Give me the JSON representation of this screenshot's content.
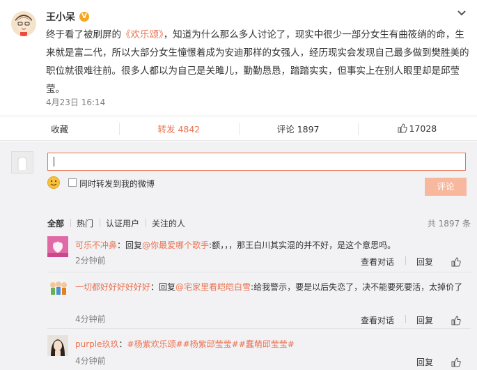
{
  "post": {
    "author": "王小呆",
    "verify_badge": "V",
    "text_before": "终于看了被刷屏的",
    "link": "《欢乐颂》",
    "text_after": "，知道为什么那么多人讨论了，现实中很少一部分女生有曲筱绡的命，生来就是富二代，所以大部分女生憧憬着成为安迪那样的女强人，经历现实会发现自己最多做到樊胜美的职位就很难往前。很多人都以为自己是关雎儿，勤勤恳恳，踏踏实实，但事实上在别人眼里却是邱莹莹。",
    "time": "4月23日 16:14"
  },
  "actions": {
    "favorite": "收藏",
    "repost": "转发 4842",
    "comment": "评论 1897",
    "like": "17028"
  },
  "composer": {
    "input_value": "",
    "also_repost_label": "同时转发到我的微博",
    "submit_label": "评论"
  },
  "filters": {
    "items": [
      "全部",
      "热门",
      "认证用户",
      "关注的人"
    ],
    "total": "共 1897 条"
  },
  "comments": [
    {
      "user": "可乐不冲鼻",
      "prefix": "：回复",
      "at": "@你最爱哪个歌手",
      "text": ":额，，，那王白川其实混的并不好，是这个意思吗。",
      "time": "2分钟前",
      "view": "查看对话",
      "reply": "回复"
    },
    {
      "user": "一切都好好好好好好",
      "prefix": "：回复",
      "at": "@宅家里看皑皑白雪",
      "text": ":给我警示，要是以后失恋了，决不能要死要活，太掉价了",
      "time": "4分钟前",
      "view": "查看对话",
      "reply": "回复"
    },
    {
      "user": "purple玖玖",
      "prefix": "：",
      "tags": "#杨紫欢乐颂##杨紫邱莹莹##蠢萌邱莹莹#",
      "time": "4分钟前",
      "reply": "回复"
    }
  ],
  "colors": {
    "accent": "#eb7350",
    "submit_disabled": "#f7b89d",
    "badge": "#f5a623"
  }
}
